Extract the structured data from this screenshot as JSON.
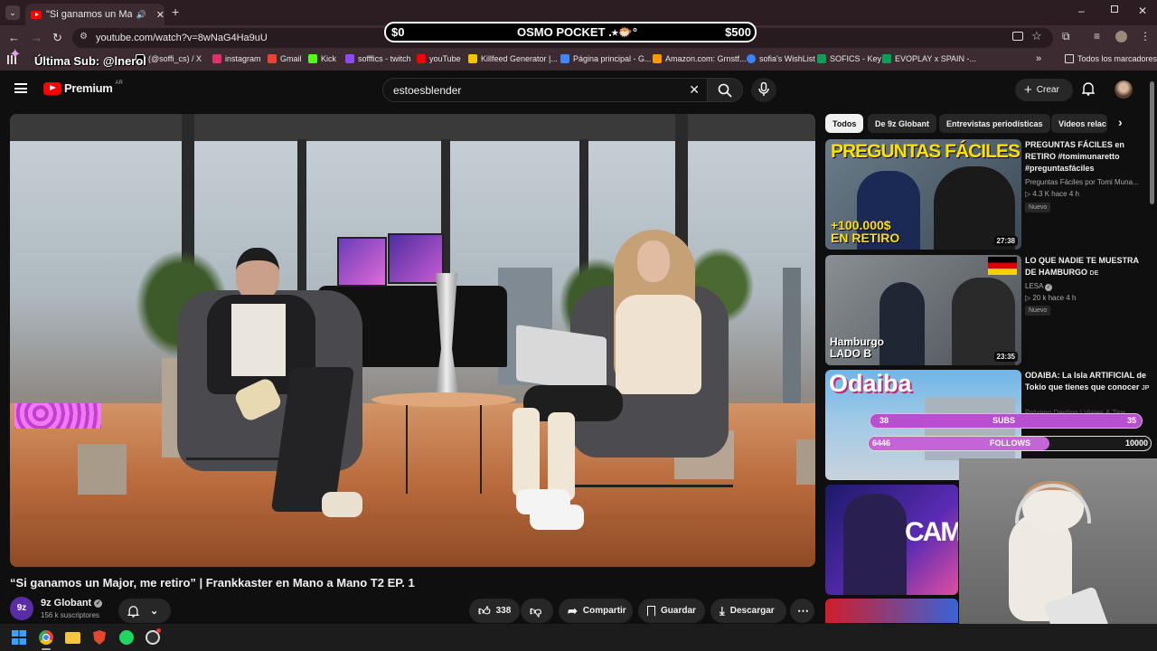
{
  "browser": {
    "tab_title": "\"Si ganamos un Major, me ...",
    "url": "youtube.com/watch?v=8wNaG4Ha9uU",
    "bookmarks": [
      {
        "label": "(@soffi_cs) / X",
        "color": "#ffffff"
      },
      {
        "label": "instagram",
        "color": "#e1306c"
      },
      {
        "label": "Gmail",
        "color": "#ea4335"
      },
      {
        "label": "Kick",
        "color": "#53fc18"
      },
      {
        "label": "sofffics - twitch",
        "color": "#9146ff"
      },
      {
        "label": "youTube",
        "color": "#ff0000"
      },
      {
        "label": "Killfeed Generator |...",
        "color": "#f5c400"
      },
      {
        "label": "Página principal - G...",
        "color": "#4285f4"
      },
      {
        "label": "Amazon.com: Grnstf...",
        "color": "#ff9900"
      },
      {
        "label": "sofia's WishList",
        "color": "#3b82f6"
      },
      {
        "label": "SOFICS - Key",
        "color": "#0f9d58"
      },
      {
        "label": "EVOPLAY x SPAIN -...",
        "color": "#0f9d58"
      }
    ],
    "all_bookmarks": "Todos los marcadores"
  },
  "overlay": {
    "osmo_left": "$0",
    "osmo_title": "OSMO POCKET .⭑🐡°",
    "osmo_right": "$500",
    "ultima_sub": "Última Sub: @lnerol",
    "subs_left": "38",
    "subs_label": "SUBS",
    "subs_right": "35",
    "subs_progress": 1.0,
    "follows_left": "6446",
    "follows_label": "FOLLOWS",
    "follows_right": "10000",
    "follows_progress": 0.64
  },
  "youtube": {
    "logo_text": "Premium",
    "logo_region": "AR",
    "search_value": "estoesblender",
    "create_label": "Crear",
    "chips": [
      "Todos",
      "De 9z Globant",
      "Entrevistas periodísticas",
      "Videos relac"
    ],
    "video_title": "“Si ganamos un Major, me retiro” | Frankkaster en Mano a Mano T2 EP. 1",
    "channel_name": "9z Globant",
    "channel_subs": "156 k suscriptores",
    "likes": "338",
    "share_label": "Compartir",
    "save_label": "Guardar",
    "download_label": "Descargar",
    "recommendations": [
      {
        "title": "PREGUNTAS FÁCILES en RETIRO #tomimunaretto #preguntasfáciles",
        "channel": "Preguntas Fáciles por Tomi Muna...",
        "stats": "4.3 K  hace 4 h",
        "badge": "Nuevo",
        "duration": "27:38",
        "thumb_top": "PREGUNTAS FÁCILES",
        "thumb_bottom": "+100.000$ EN RETIRO"
      },
      {
        "title": "LO QUE NADIE TE MUESTRA DE HAMBURGO",
        "title_suffix": "DE",
        "channel": "LESA",
        "stats": "20 k  hace 4 h",
        "badge": "Nuevo",
        "duration": "23:35",
        "thumb_bottom": "Hamburgo LADO B"
      },
      {
        "title": "ODAIBA: La Isla ARTIFICIAL de Tokio que tienes que conocer",
        "title_suffix": "JP",
        "channel": "Próximo Destino | Viajes & Tips",
        "thumb_top": "Odaiba"
      },
      {
        "thumb_top": "CAMP"
      }
    ]
  }
}
